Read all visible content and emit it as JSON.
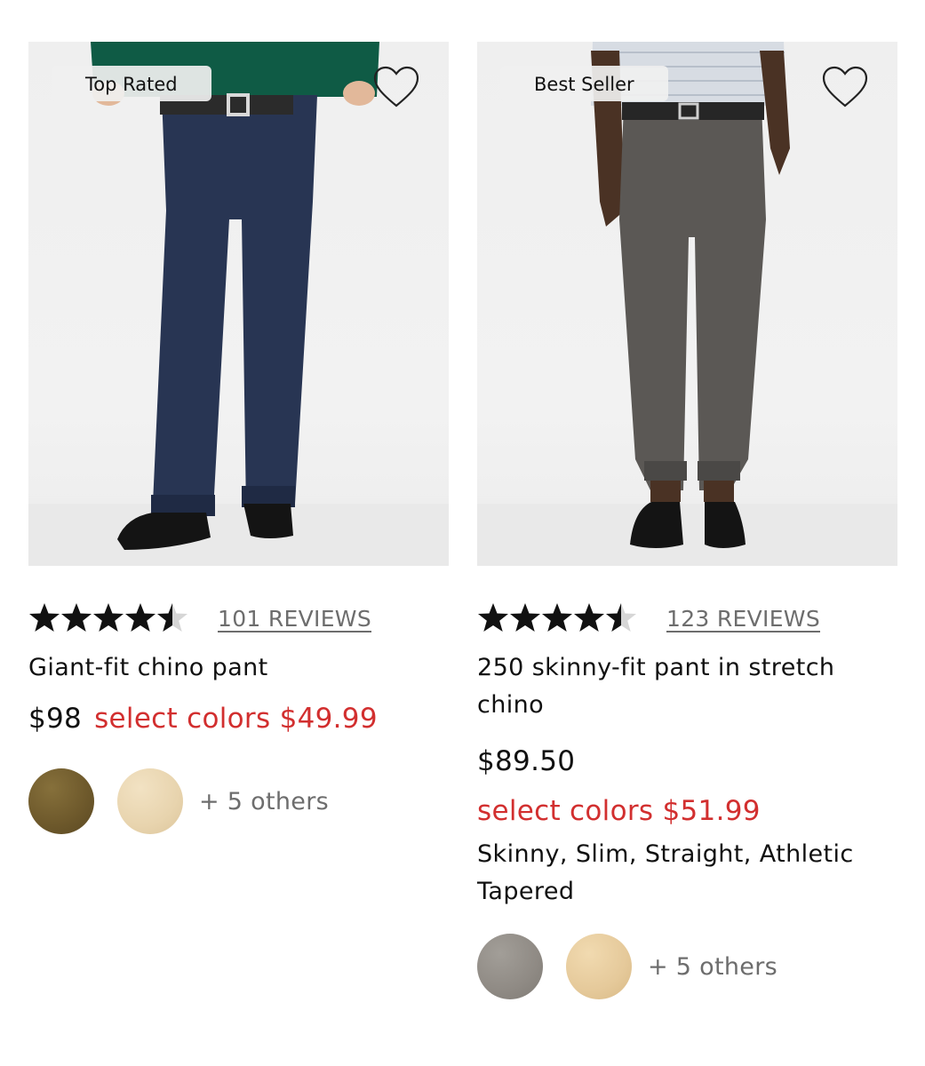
{
  "products": [
    {
      "badge": "Top Rated",
      "rating": 4.5,
      "reviews": "101 REVIEWS",
      "title": "Giant-fit chino pant",
      "price": "$98",
      "sale": "select colors $49.99",
      "others": "+ 5 others",
      "swatch_colors": [
        "#6f5a2c",
        "#e8d4ae"
      ],
      "pant_color": "#283553",
      "sweater_color": "#0f5b45",
      "icons": {
        "wishlist": "heart-outline-icon",
        "star": "star-icon"
      }
    },
    {
      "badge": "Best Seller",
      "rating": 4.5,
      "reviews": "123 REVIEWS",
      "title_line1": "250 skinny-fit pant in stretch",
      "title_line2": "chino",
      "price": "$89.50",
      "sale": "select colors $51.99",
      "fits_line1": "Skinny, Slim, Straight, Athletic",
      "fits_line2": "Tapered",
      "others": "+ 5 others",
      "swatch_colors": [
        "#8f8a84",
        "#e5c99a"
      ],
      "pant_color": "#5b5855",
      "shirt_color": "#d7dce3",
      "icons": {
        "wishlist": "heart-outline-icon",
        "star": "star-icon"
      }
    }
  ],
  "colors": {
    "sale_red": "#d22f2f",
    "muted_gray": "#6d6d6d",
    "star_black": "#111111"
  }
}
